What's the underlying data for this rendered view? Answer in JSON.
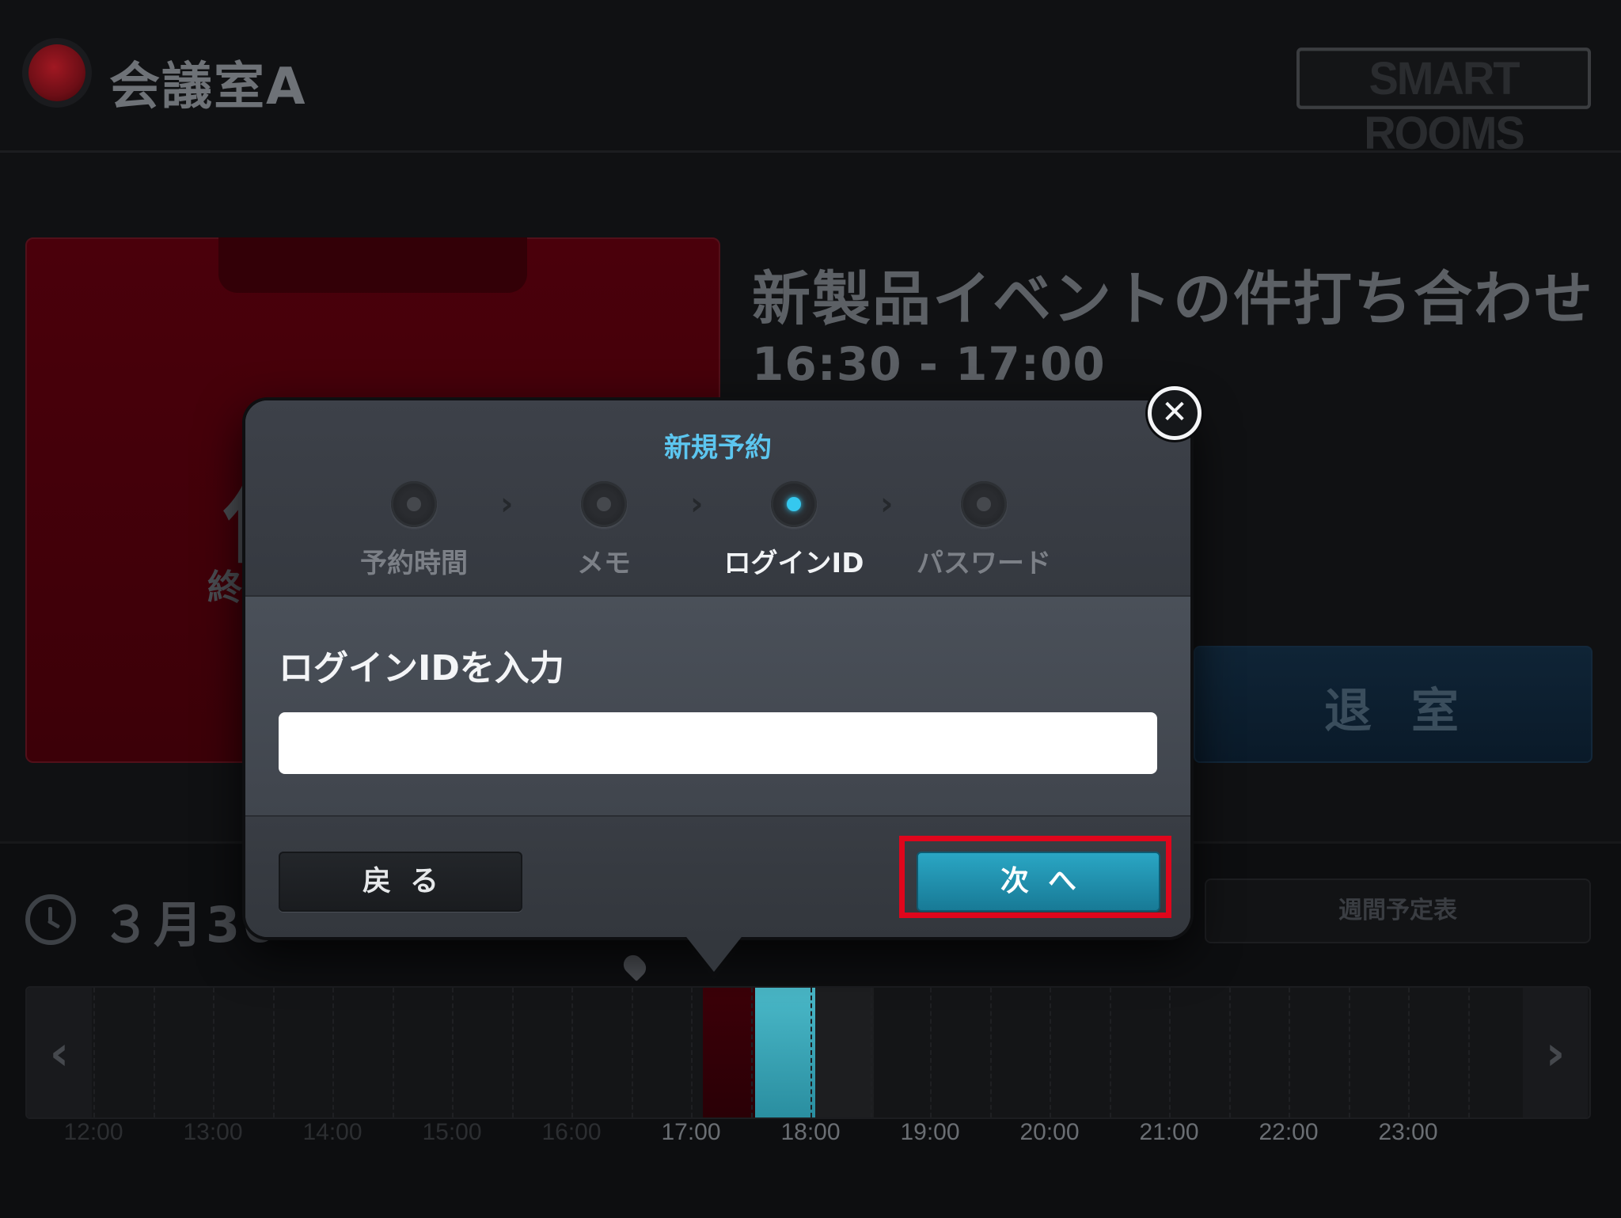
{
  "header": {
    "room_name": "会議室A",
    "brand": "SMART ROOMS"
  },
  "status_card": {
    "big_char": "使",
    "small_char": "終"
  },
  "event": {
    "title": "新製品イベントの件打ち合わせ",
    "time": "16:30 - 17:00"
  },
  "exit_button": {
    "label": "退室"
  },
  "schedule": {
    "date": "３月30",
    "weekly_button": "週間予定表"
  },
  "timeline": {
    "prev_icon": "chevron-left-icon",
    "next_icon": "chevron-right-icon",
    "ticks": [
      "12:00",
      "13:00",
      "14:00",
      "15:00",
      "16:00",
      "17:00",
      "18:00",
      "19:00",
      "20:00",
      "21:00",
      "22:00",
      "23:00"
    ]
  },
  "modal": {
    "title": "新規予約",
    "steps": [
      {
        "label": "予約時間"
      },
      {
        "label": "メモ"
      },
      {
        "label": "ログインID"
      },
      {
        "label": "パスワード"
      }
    ],
    "active_step": 2,
    "input_label": "ログインIDを入力",
    "input_value": "",
    "back_label": "戻る",
    "next_label": "次へ",
    "close_icon": "close-icon"
  },
  "colors": {
    "accent": "#5cc6ef",
    "next_button": "#2aa6c4",
    "highlight": "#e0061c",
    "busy_red": "#4a000b"
  }
}
